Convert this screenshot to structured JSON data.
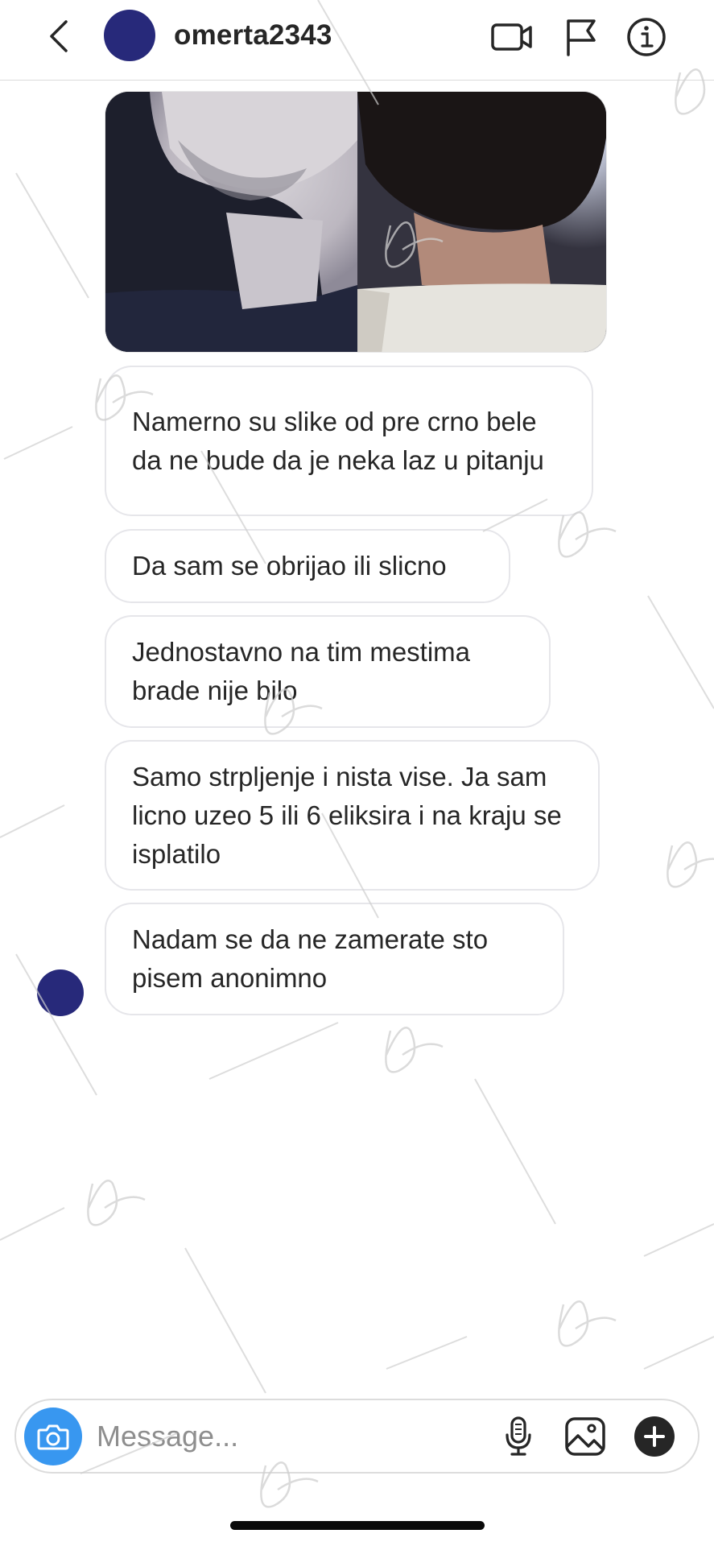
{
  "header": {
    "back_icon": "chevron-left-icon",
    "username": "omerta2343",
    "actions": [
      "video-call-icon",
      "flag-icon",
      "info-icon"
    ]
  },
  "conversation": {
    "image_message": {
      "description_icons": [
        "photo-before",
        "photo-after"
      ]
    },
    "messages": [
      {
        "text": "Namerno su slike od pre crno bele da ne bude da je neka laz u pitanju"
      },
      {
        "text": "Da sam se obrijao ili slicno"
      },
      {
        "text": "Jednostavno na tim mestima brade nije bilo"
      },
      {
        "text": "Samo strpljenje i nista vise. Ja sam licno uzeo 5 ili 6 eliksira i na kraju se isplatilo"
      },
      {
        "text": "Nadam se da ne zamerate sto pisem anonimno"
      }
    ]
  },
  "composer": {
    "placeholder": "Message...",
    "camera_icon": "camera-icon",
    "mic_icon": "microphone-icon",
    "gallery_icon": "gallery-icon",
    "plus_icon": "plus-icon"
  },
  "colors": {
    "avatar": "#27297a",
    "camera_button": "#3897f0",
    "bubble_border": "#e6e6ea",
    "text": "#262626",
    "placeholder": "#8e8e8e"
  }
}
